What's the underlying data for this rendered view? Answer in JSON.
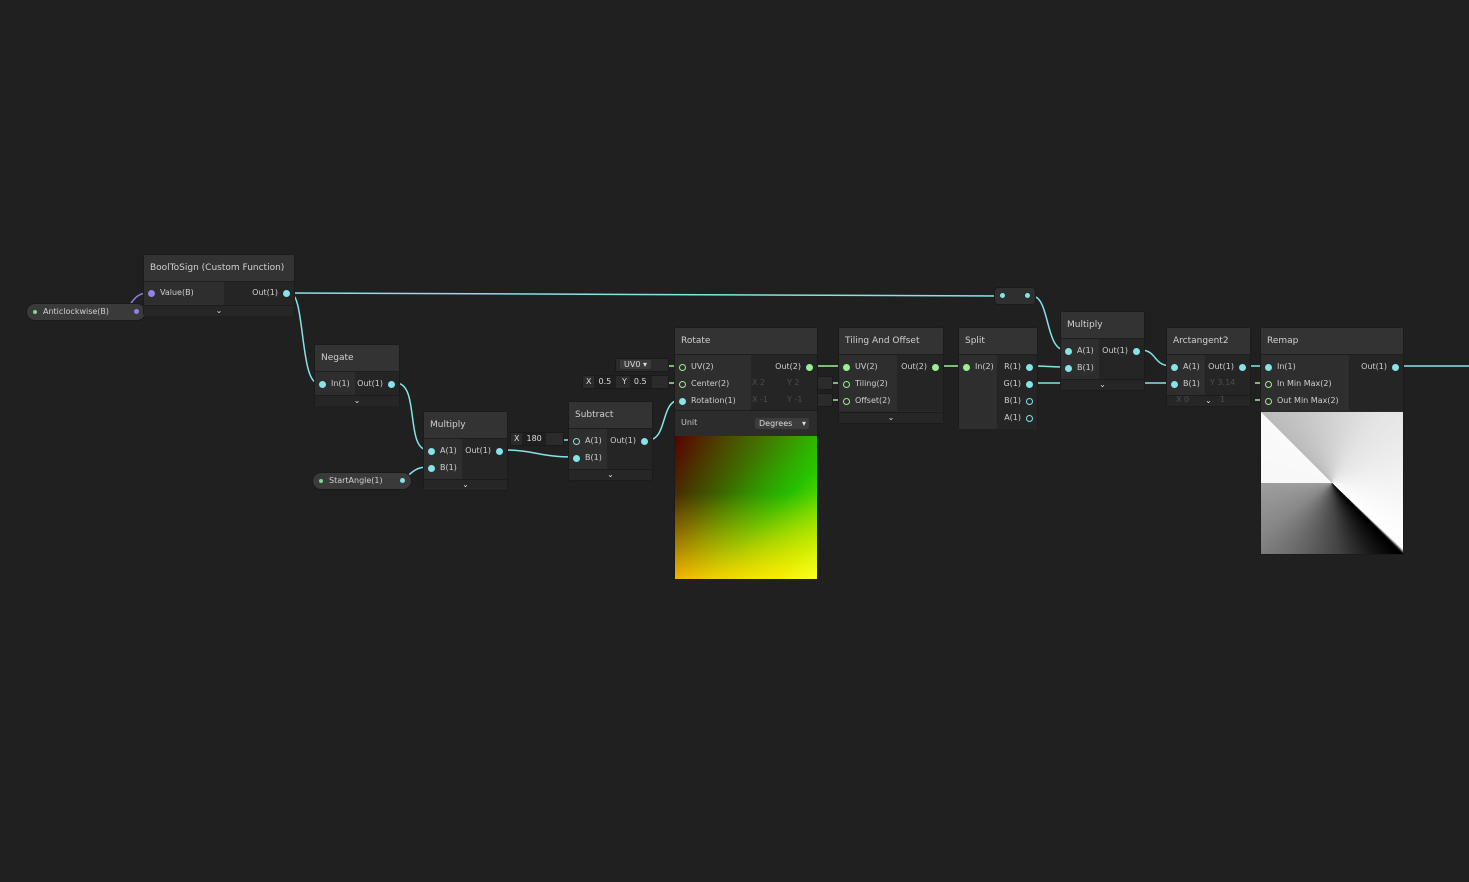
{
  "properties": {
    "anticlockwise": "Anticlockwise(B)",
    "start_angle": "StartAngle(1)"
  },
  "nodes": {
    "booltosign": {
      "title": "BoolToSign (Custom Function)",
      "in_value": "Value(B)",
      "out": "Out(1)"
    },
    "negate": {
      "title": "Negate",
      "in": "In(1)",
      "out": "Out(1)"
    },
    "multiply1": {
      "title": "Multiply",
      "a": "A(1)",
      "b": "B(1)",
      "out": "Out(1)"
    },
    "subtract": {
      "title": "Subtract",
      "a": "A(1)",
      "b": "B(1)",
      "out": "Out(1)",
      "a_label": "X",
      "a_value": "180"
    },
    "rotate": {
      "title": "Rotate",
      "uv": "UV(2)",
      "center": "Center(2)",
      "rotation": "Rotation(1)",
      "out": "Out(2)",
      "unit_label": "Unit",
      "unit_value": "Degrees",
      "uv_channel": "UV0",
      "center_x_label": "X",
      "center_x": "0.5",
      "center_y_label": "Y",
      "center_y": "0.5"
    },
    "tiling": {
      "title": "Tiling And Offset",
      "uv": "UV(2)",
      "tiling": "Tiling(2)",
      "offset": "Offset(2)",
      "out": "Out(2)",
      "ghost_tiling_x": "X 2",
      "ghost_tiling_y": "Y 2",
      "ghost_offset_x": "X -1",
      "ghost_offset_y": "Y -1"
    },
    "split": {
      "title": "Split",
      "in": "In(2)",
      "r": "R(1)",
      "g": "G(1)",
      "b": "B(1)",
      "a": "A(1)"
    },
    "multiply2": {
      "title": "Multiply",
      "a": "A(1)",
      "b": "B(1)",
      "out": "Out(1)"
    },
    "arctangent2": {
      "title": "Arctangent2",
      "a": "A(1)",
      "b": "B(1)",
      "out": "Out(1)",
      "ghost1": "Y 3.14",
      "ghost2": "X 0",
      "ghost3": "1"
    },
    "remap": {
      "title": "Remap",
      "in": "In(1)",
      "in_min_max": "In Min Max(2)",
      "out_min_max": "Out Min Max(2)",
      "out": "Out(1)"
    }
  },
  "colors": {
    "background": "#202020",
    "float_wire": "#84e4e7",
    "vector2_wire": "#9aef92",
    "bool_wire": "#9481e6"
  },
  "icons": {
    "expander": "chevron-down-icon",
    "dropdown": "caret-down-icon"
  }
}
